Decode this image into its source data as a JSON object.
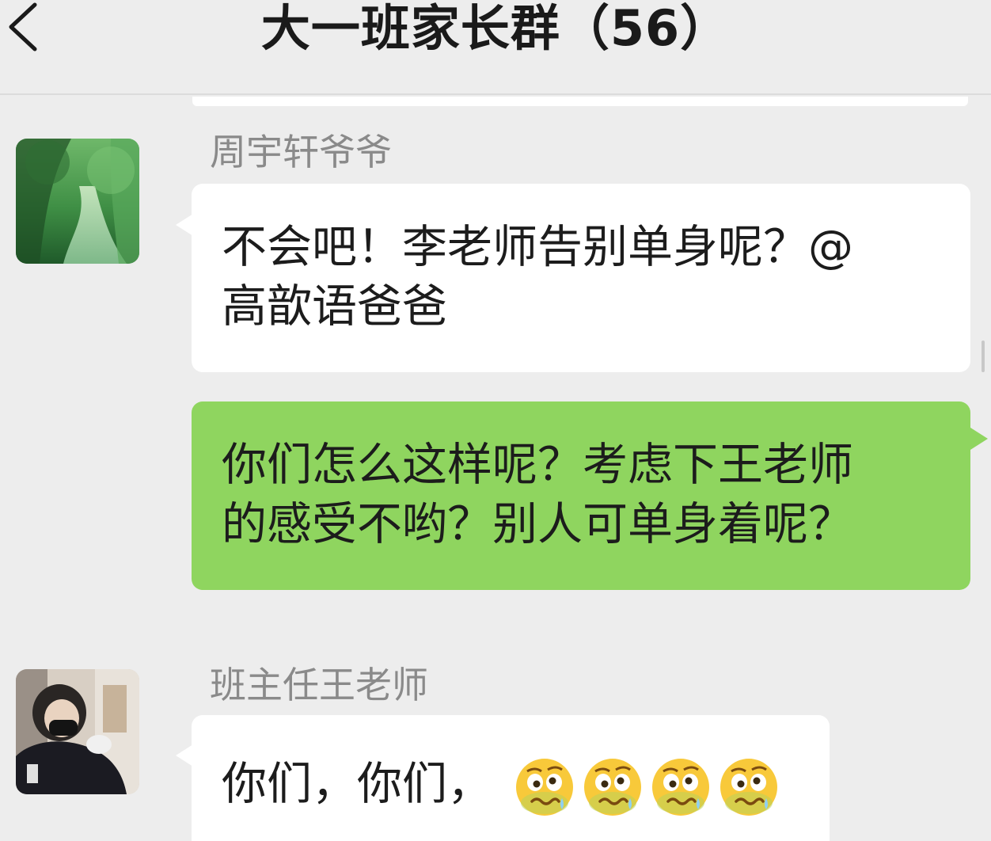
{
  "header": {
    "title": "大一班家长群（56）",
    "back_icon": "chevron-left-icon"
  },
  "messages": [
    {
      "sender": "周宇轩爷爷",
      "side": "left",
      "lines": [
        "不会吧！李老师告别单身呢？@",
        "高歆语爸爸"
      ]
    },
    {
      "sender": "",
      "side": "right",
      "lines": [
        "你们怎么这样呢？考虑下王老师",
        "的感受不哟？别人可单身着呢？"
      ]
    },
    {
      "sender": "班主任王老师",
      "side": "left",
      "lines": [
        "你们，你们，"
      ],
      "emojis": [
        "woozy-face-icon",
        "woozy-face-icon",
        "woozy-face-icon",
        "woozy-face-icon"
      ]
    }
  ],
  "colors": {
    "background": "#ededed",
    "bubble_self": "#8fd55f",
    "bubble_other": "#ffffff",
    "sender_name": "#8a8a8a"
  }
}
